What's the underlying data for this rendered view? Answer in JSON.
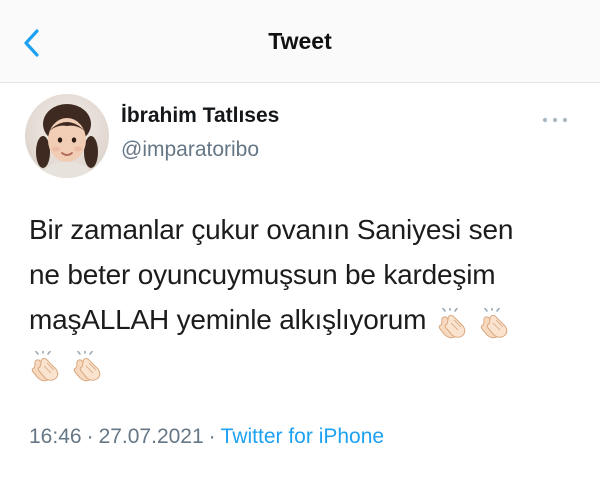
{
  "header": {
    "title": "Tweet"
  },
  "tweet": {
    "author": {
      "display_name": "İbrahim Tatlıses",
      "handle": "@imparatoribo"
    },
    "text_lines": [
      "Bir zamanlar çukur ovanın Saniyesi sen",
      "ne beter oyuncuymuşsun be kardeşim",
      "maşALLAH yeminle alkışlıyorum"
    ],
    "emoji": "clapping-hands",
    "time": "16:46",
    "separator": "·",
    "date": "27.07.2021",
    "source": "Twitter for iPhone"
  },
  "colors": {
    "accent": "#1da1f2",
    "secondary_text": "#657786",
    "divider": "#e1e8ed"
  },
  "icons": {
    "back": "chevron-left-icon",
    "more": "ellipsis-icon",
    "clap": "clapping-hands-icon"
  }
}
